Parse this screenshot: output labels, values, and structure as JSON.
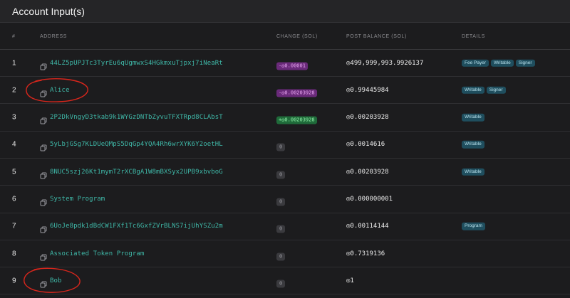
{
  "card": {
    "title": "Account Input(s)"
  },
  "columns": [
    "#",
    "ADDRESS",
    "CHANGE (SOL)",
    "POST BALANCE (SOL)",
    "DETAILS"
  ],
  "colors": {
    "accent": "#3fb8a8",
    "annotation": "#d9261c",
    "tag_bg": "#1f4e5e"
  },
  "rows": [
    {
      "index": "1",
      "address": "44LZ5pUPJTc3TyrEu6qUgmwxS4HGkmxuTjpxj7iNeaRt",
      "change": "-◎0.00001",
      "change_kind": "neg",
      "balance": "◎499,999,993.9926137",
      "tags": [
        "Fee Payer",
        "Writable",
        "Signer"
      ]
    },
    {
      "index": "2",
      "address": "Alice",
      "change": "-◎0.00203928",
      "change_kind": "neg",
      "balance": "◎0.99445984",
      "tags": [
        "Writable",
        "Signer"
      ]
    },
    {
      "index": "3",
      "address": "2P2DkVngyD3tkab9k1WYGzDNTbZyvuTFXTRpd8CLAbsT",
      "change": "+◎0.00203928",
      "change_kind": "pos",
      "balance": "◎0.00203928",
      "tags": [
        "Writable"
      ]
    },
    {
      "index": "4",
      "address": "5yLbjGSg7KLDUeQMpS5DqGp4YQA4Rh6wrXYK6Y2oetHL",
      "change": "0",
      "change_kind": "zero",
      "balance": "◎0.0014616",
      "tags": [
        "Writable"
      ]
    },
    {
      "index": "5",
      "address": "8NUC5szj26Kt1mymT2rXCBgA1W8mBXSyx2UPB9xbvboG",
      "change": "0",
      "change_kind": "zero",
      "balance": "◎0.00203928",
      "tags": [
        "Writable"
      ]
    },
    {
      "index": "6",
      "address": "System Program",
      "change": "0",
      "change_kind": "zero",
      "balance": "◎0.000000001",
      "tags": []
    },
    {
      "index": "7",
      "address": "6UoJe8pdk1dBdCW1FXf1Tc6GxfZVrBLNS7ijUhYSZu2m",
      "change": "0",
      "change_kind": "zero",
      "balance": "◎0.00114144",
      "tags": [
        "Program"
      ]
    },
    {
      "index": "8",
      "address": "Associated Token Program",
      "change": "0",
      "change_kind": "zero",
      "balance": "◎0.7319136",
      "tags": []
    },
    {
      "index": "9",
      "address": "Bob",
      "change": "0",
      "change_kind": "zero",
      "balance": "◎1",
      "tags": []
    }
  ]
}
